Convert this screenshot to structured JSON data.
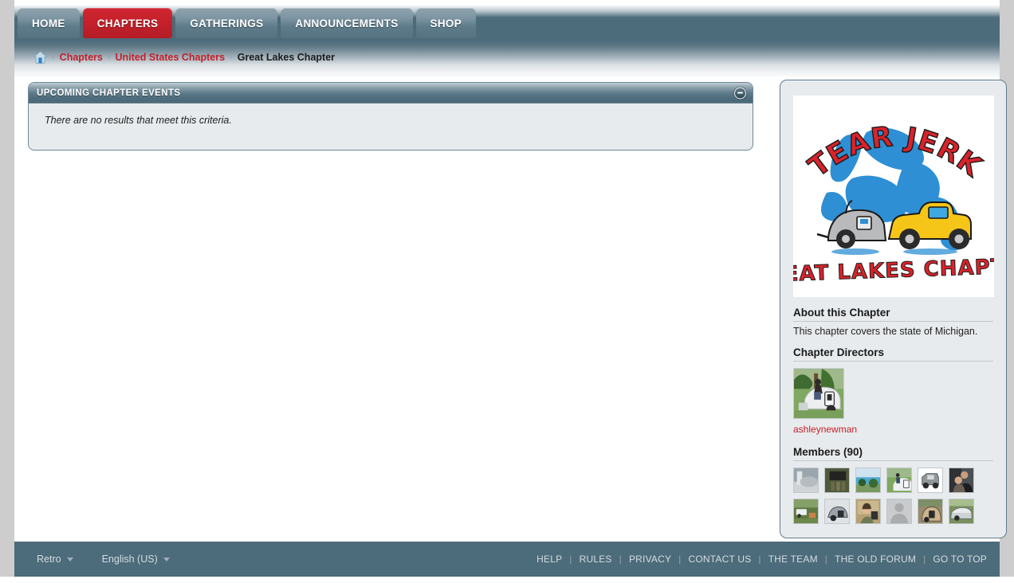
{
  "nav": {
    "items": [
      {
        "label": "HOME",
        "active": false
      },
      {
        "label": "CHAPTERS",
        "active": true
      },
      {
        "label": "GATHERINGS",
        "active": false
      },
      {
        "label": "ANNOUNCEMENTS",
        "active": false
      },
      {
        "label": "SHOP",
        "active": false
      }
    ]
  },
  "breadcrumb": {
    "home_icon": "home-icon",
    "separator": "›",
    "items": [
      {
        "label": "Chapters",
        "current": false
      },
      {
        "label": "United States Chapters",
        "current": false
      },
      {
        "label": "Great Lakes Chapter",
        "current": true
      }
    ]
  },
  "main_panel": {
    "title": "UPCOMING CHAPTER EVENTS",
    "collapse_icon": "minus-circle-icon",
    "empty_message": "There are no results that meet this criteria."
  },
  "sidebar": {
    "logo": {
      "alt": "Tear Jerkers Great Lakes Chapter logo",
      "top_text": "TEAR JERKERS",
      "bottom_text": "GREAT LAKES CHAPTER"
    },
    "about": {
      "heading": "About this Chapter",
      "text": "This chapter covers the state of Michigan."
    },
    "directors": {
      "heading": "Chapter Directors",
      "list": [
        {
          "name": "ashleynewman",
          "avatar": "teardrop-trailer-photo"
        }
      ]
    },
    "members": {
      "heading": "Members (90)",
      "count": 90,
      "thumbs": [
        "silver-trailer-photo",
        "dark-truck-group-photo",
        "lake-shore-photo",
        "person-on-teardrop-photo",
        "rv-white-background-photo",
        "couple-portrait-photo",
        "campsite-photo",
        "gray-teardrop-photo",
        "person-indoors-photo",
        "default-silhouette-avatar",
        "tan-teardrop-photo",
        "aluminum-trailer-photo"
      ]
    }
  },
  "footer": {
    "style_selector": {
      "label": "Retro",
      "icon": "chevron-down-icon"
    },
    "language_selector": {
      "label": "English (US)",
      "icon": "chevron-down-icon"
    },
    "separator": "|",
    "links": [
      "HELP",
      "RULES",
      "PRIVACY",
      "CONTACT US",
      "THE TEAM",
      "THE OLD FORUM",
      "GO TO TOP"
    ]
  },
  "colors": {
    "accent_red": "#c2202a",
    "header_slate": "#4c6b7b",
    "panel_bg": "#e8ebed",
    "page_margin": "#cdcdcd"
  }
}
